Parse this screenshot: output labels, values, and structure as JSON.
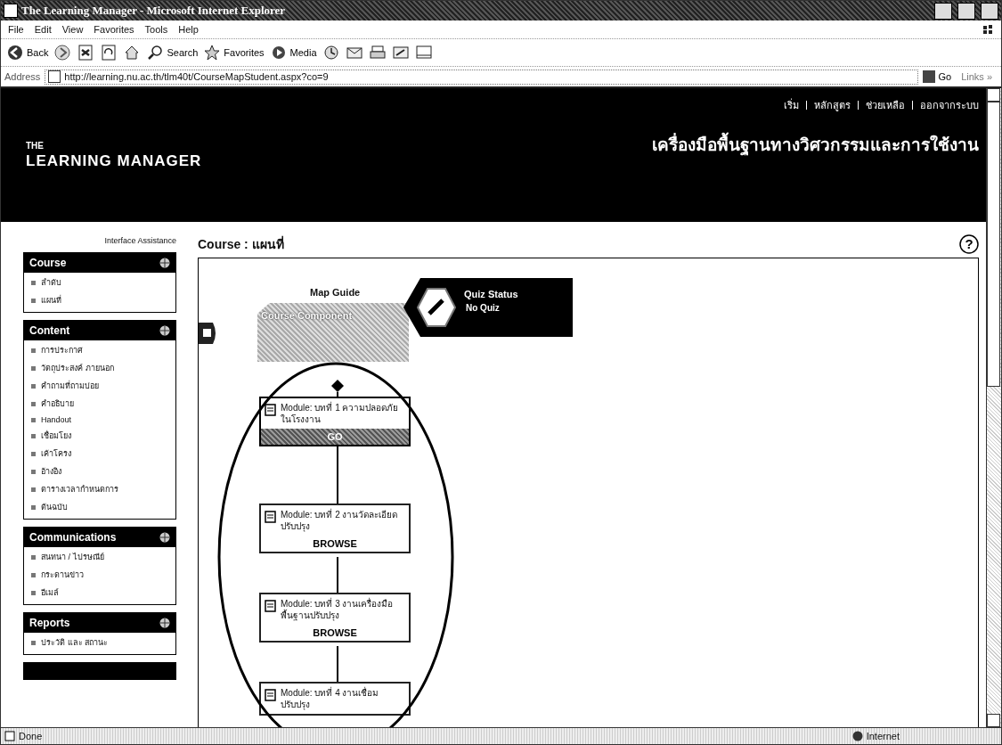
{
  "window": {
    "title": "The Learning Manager - Microsoft Internet Explorer"
  },
  "menu": [
    "File",
    "Edit",
    "View",
    "Favorites",
    "Tools",
    "Help"
  ],
  "toolbar": [
    {
      "kind": "back",
      "label": "Back"
    },
    {
      "kind": "forward"
    },
    {
      "kind": "stop"
    },
    {
      "kind": "refresh"
    },
    {
      "kind": "home"
    },
    {
      "kind": "search",
      "label": "Search"
    },
    {
      "kind": "favorites",
      "label": "Favorites"
    },
    {
      "kind": "media",
      "label": "Media"
    },
    {
      "kind": "history"
    },
    {
      "kind": "mail"
    },
    {
      "kind": "print"
    },
    {
      "kind": "edit"
    },
    {
      "kind": "discuss"
    }
  ],
  "address": {
    "label": "Address",
    "value": "http://learning.nu.ac.th/tlm40t/CourseMapStudent.aspx?co=9",
    "go": "Go",
    "links": "Links",
    "more": "»"
  },
  "banner": {
    "logo_top": "THE",
    "logo_main": "LEARNING MANAGER",
    "nav": [
      "เริ่ม",
      "หลักสูตร",
      "ช่วยเหลือ",
      "ออกจากระบบ"
    ],
    "subtitle": "เครื่องมือพื้นฐานทางวิศวกรรมและการใช้งาน"
  },
  "sidebar": {
    "assist": "Interface Assistance",
    "panels": [
      {
        "title": "Course",
        "items": [
          "ลำดับ",
          "แผนที่"
        ]
      },
      {
        "title": "Content",
        "items": [
          "การประกาศ",
          "วัตถุประสงค์ ภายนอก",
          "คำถามที่ถามบ่อย",
          "คำอธิบาย",
          "Handout",
          "เชื่อมโยง",
          "เค้าโครง",
          "อ้างอิง",
          "ตารางเวลากำหนดการ",
          "ต้นฉบับ"
        ]
      },
      {
        "title": "Communications",
        "items": [
          "สนทนา / ไปรษณีย์",
          "กระดานข่าว",
          "อีเมล์"
        ]
      },
      {
        "title": "Reports",
        "items": [
          "ประวัติ และ สถานะ"
        ]
      }
    ]
  },
  "page": {
    "title": "Course : แผนที่",
    "help": "?"
  },
  "map": {
    "guide": "Map Guide",
    "component": {
      "title": "Course Component"
    },
    "quiz": {
      "title": "Quiz Status",
      "status": "No Quiz"
    },
    "modules": [
      {
        "title": "Module: บทที่ 1 ความปลอดภัยในโรงงาน",
        "action": "GO",
        "current": true
      },
      {
        "title": "Module: บทที่ 2 งานวัดละเอียดปรับปรุง",
        "action": "BROWSE",
        "current": false
      },
      {
        "title": "Module: บทที่ 3 งานเครื่องมือพื้นฐานปรับปรุง",
        "action": "BROWSE",
        "current": false
      },
      {
        "title": "Module: บทที่ 4 งานเชื่อมปรับปรุง"
      }
    ]
  },
  "status_bar": {
    "text": "Done",
    "zone": "Internet"
  }
}
